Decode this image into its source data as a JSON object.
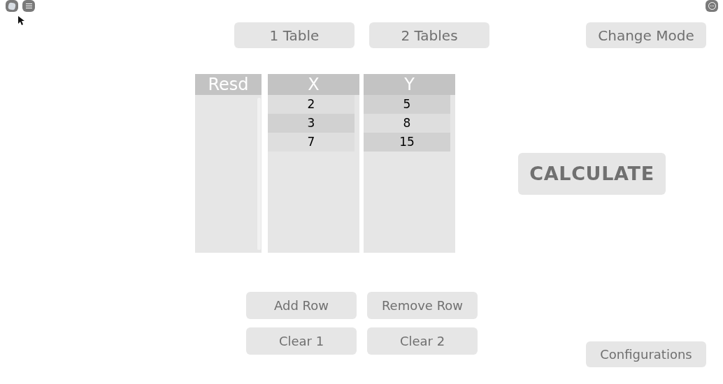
{
  "top_buttons": [
    "1 Table",
    "2 Tables",
    "Change Mode"
  ],
  "columns": [
    {
      "header": "Resd"
    },
    {
      "header": "X",
      "cells": [
        {
          "text": "2",
          "shaded": false
        },
        {
          "text": "3",
          "shaded": true
        },
        {
          "text": "7",
          "shaded": false
        }
      ]
    },
    {
      "header": "Y",
      "cells": [
        {
          "text": "5",
          "shaded": true
        },
        {
          "text": "8",
          "shaded": false
        },
        {
          "text": "15",
          "shaded": true
        }
      ]
    }
  ],
  "calculate": "CALCULATE",
  "row_buttons": [
    "Add Row",
    "Remove Row",
    "Clear 1",
    "Clear 2"
  ],
  "config_button": "Configurations"
}
